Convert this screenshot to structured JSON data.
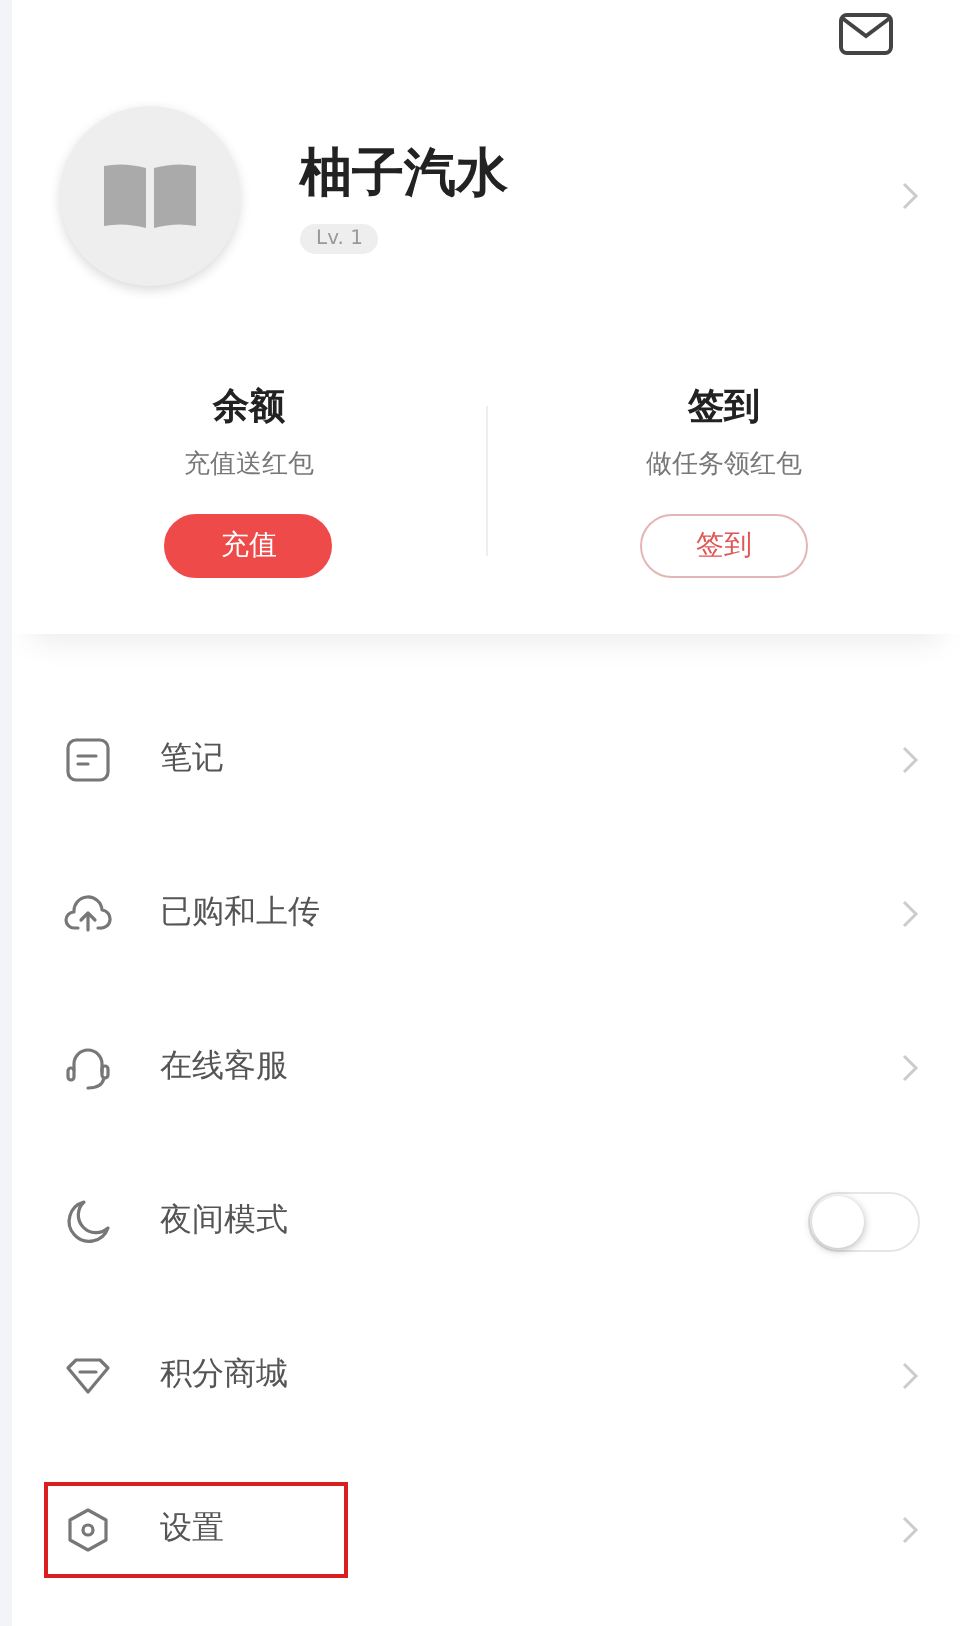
{
  "profile": {
    "name": "柚子汽水",
    "level": "Lv. 1"
  },
  "wallet": [
    {
      "title": "余额",
      "subtitle": "充值送红包",
      "button": "充值",
      "primary": true
    },
    {
      "title": "签到",
      "subtitle": "做任务领红包",
      "button": "签到",
      "primary": false
    }
  ],
  "menu": [
    {
      "kind": "link",
      "label": "笔记",
      "highlighted": false
    },
    {
      "kind": "link",
      "label": "已购和上传",
      "highlighted": false
    },
    {
      "kind": "link",
      "label": "在线客服",
      "highlighted": false
    },
    {
      "kind": "toggle",
      "label": "夜间模式",
      "on": false,
      "highlighted": false
    },
    {
      "kind": "link",
      "label": "积分商城",
      "highlighted": false
    },
    {
      "kind": "link",
      "label": "设置",
      "highlighted": true
    }
  ]
}
